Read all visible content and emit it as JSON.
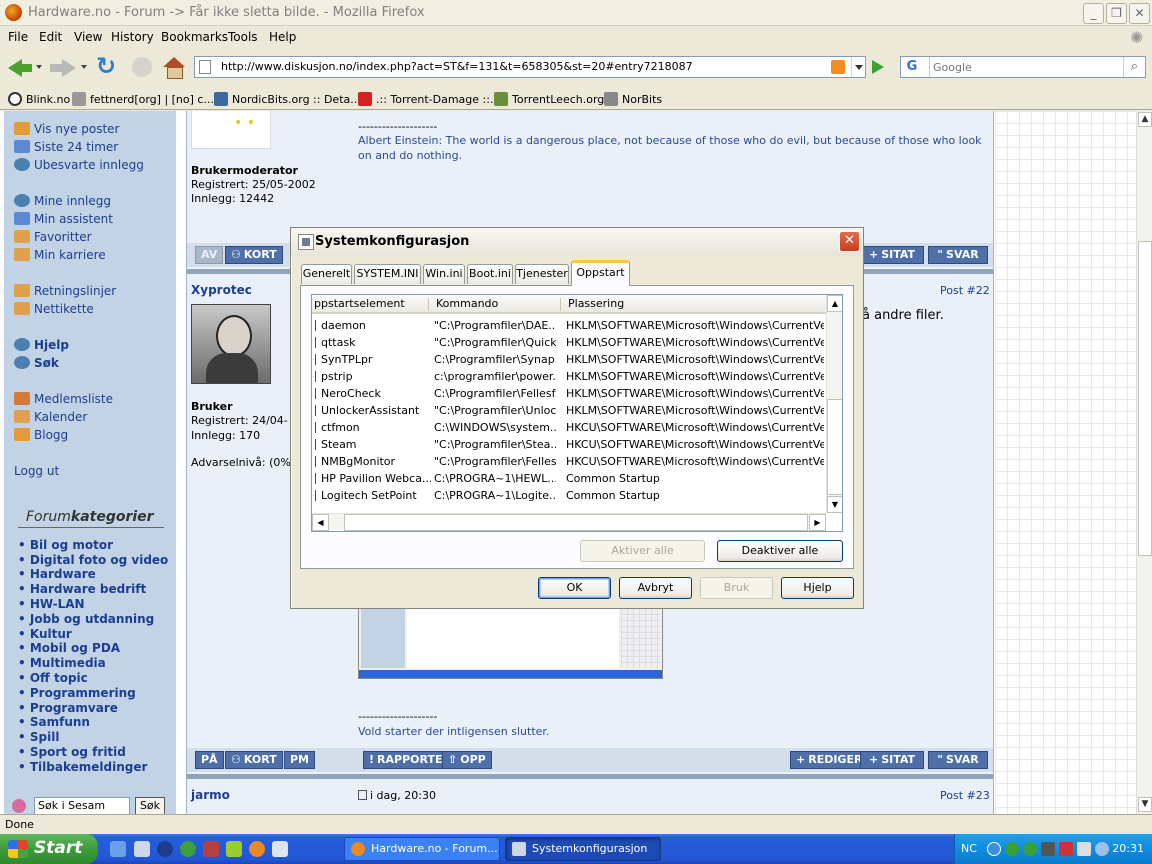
{
  "window": {
    "title": "Hardware.no - Forum -> Får ikke sletta bilde. - Mozilla Firefox"
  },
  "menu": [
    "File",
    "Edit",
    "View",
    "History",
    "Bookmarks",
    "Tools",
    "Help"
  ],
  "nav": {
    "url": "http://www.diskusjon.no/index.php?act=ST&f=131&t=658305&st=20#entry7218087",
    "search_placeholder": "Google"
  },
  "bookmarks": [
    "Blink.no",
    "fettnerd[org] | [no] c...",
    "NordicBits.org :: Deta...",
    ".:: Torrent-Damage ::.",
    "TorrentLeech.org",
    "NorBits"
  ],
  "sidebar": {
    "links": [
      "Vis nye poster",
      "Siste 24 timer",
      "Ubesvarte innlegg",
      "Mine innlegg",
      "Min assistent",
      "Favoritter",
      "Min karriere",
      "Retningslinjer",
      "Nettikette",
      "Hjelp",
      "Søk",
      "Medlemsliste",
      "Kalender",
      "Blogg",
      "Logg ut"
    ],
    "category_prefix": "Forum",
    "category_suffix": "kategorier",
    "categories": [
      "Bil og motor",
      "Digital foto og video",
      "Hardware",
      "Hardware bedrift",
      "HW-LAN",
      "Jobb og utdanning",
      "Kultur",
      "Mobil og PDA",
      "Multimedia",
      "Off topic",
      "Programmering",
      "Programvare",
      "Samfunn",
      "Spill",
      "Sport og fritid",
      "Tilbakemeldinger"
    ],
    "search_value": "Søk i Sesam",
    "search_button": "Søk"
  },
  "posts": {
    "first": {
      "signature_sep": "--------------------",
      "signature_line1": "Albert Einstein: The world is a dangerous place, not because of those who do evil, but because of those who look",
      "signature_line2": "on and do nothing.",
      "role": "Brukermoderator",
      "registered": "Registrert: 25/05-2002",
      "posts": "Innlegg: 12442"
    },
    "bar1": {
      "av": "AV",
      "kort": "KORT",
      "sitat": "SITAT",
      "svar": "SVAR"
    },
    "second": {
      "user": "Xyprotec",
      "post_no": "Post #22",
      "text_fragment": "å andre filer.",
      "role": "Bruker",
      "registered": "Registrert: 24/04-",
      "posts": "Innlegg: 170",
      "warning": "Advarselnivå: (0%",
      "signature_sep": "--------------------",
      "signature": "Vold starter der intligensen slutter."
    },
    "bar2": {
      "pa": "PÅ",
      "kort": "KORT",
      "pm": "PM",
      "rapporter": "RAPPORTER",
      "opp": "OPP",
      "rediger": "REDIGER",
      "sitat": "SITAT",
      "svar": "SVAR"
    },
    "third": {
      "user": "jarmo",
      "date": "i dag, 20:30",
      "post_no": "Post #23"
    }
  },
  "dialog": {
    "title": "Systemkonfigurasjon",
    "tabs": [
      "Generelt",
      "SYSTEM.INI",
      "Win.ini",
      "Boot.ini",
      "Tjenester",
      "Oppstart"
    ],
    "active_tab": "Oppstart",
    "columns": [
      "ppstartselement",
      "Kommando",
      "Plassering"
    ],
    "rows": [
      {
        "name": "daemon",
        "cmd": "\"C:\\Programfiler\\DAE...",
        "loc": "HKLM\\SOFTWARE\\Microsoft\\Windows\\CurrentVer..."
      },
      {
        "name": "qttask",
        "cmd": "\"C:\\Programfiler\\Quick...",
        "loc": "HKLM\\SOFTWARE\\Microsoft\\Windows\\CurrentVer..."
      },
      {
        "name": "SynTPLpr",
        "cmd": "C:\\Programfiler\\Synap...",
        "loc": "HKLM\\SOFTWARE\\Microsoft\\Windows\\CurrentVer..."
      },
      {
        "name": "pstrip",
        "cmd": "c:\\programfiler\\power...",
        "loc": "HKLM\\SOFTWARE\\Microsoft\\Windows\\CurrentVer..."
      },
      {
        "name": "NeroCheck",
        "cmd": "C:\\Programfiler\\Fellesf...",
        "loc": "HKLM\\SOFTWARE\\Microsoft\\Windows\\CurrentVer..."
      },
      {
        "name": "UnlockerAssistant",
        "cmd": "\"C:\\Programfiler\\Unloc...",
        "loc": "HKLM\\SOFTWARE\\Microsoft\\Windows\\CurrentVer..."
      },
      {
        "name": "ctfmon",
        "cmd": "C:\\WINDOWS\\system...",
        "loc": "HKCU\\SOFTWARE\\Microsoft\\Windows\\CurrentVer..."
      },
      {
        "name": "Steam",
        "cmd": "\"C:\\Programfiler\\Stea...",
        "loc": "HKCU\\SOFTWARE\\Microsoft\\Windows\\CurrentVer..."
      },
      {
        "name": "NMBgMonitor",
        "cmd": "\"C:\\Programfiler\\Felles...",
        "loc": "HKCU\\SOFTWARE\\Microsoft\\Windows\\CurrentVer..."
      },
      {
        "name": "HP Pavilion Webca...",
        "cmd": "C:\\PROGRA~1\\HEWL...",
        "loc": "Common Startup"
      },
      {
        "name": "Logitech SetPoint",
        "cmd": "C:\\PROGRA~1\\Logite...",
        "loc": "Common Startup"
      }
    ],
    "enable_all": "Aktiver alle",
    "disable_all": "Deaktiver alle",
    "ok": "OK",
    "cancel": "Avbryt",
    "apply": "Bruk",
    "help": "Hjelp"
  },
  "status": "Done",
  "taskbar": {
    "start": "Start",
    "tasks": [
      "Hardware.no - Forum...",
      "Systemkonfigurasjon"
    ],
    "tray_lang": "NC",
    "clock": "20:31"
  }
}
